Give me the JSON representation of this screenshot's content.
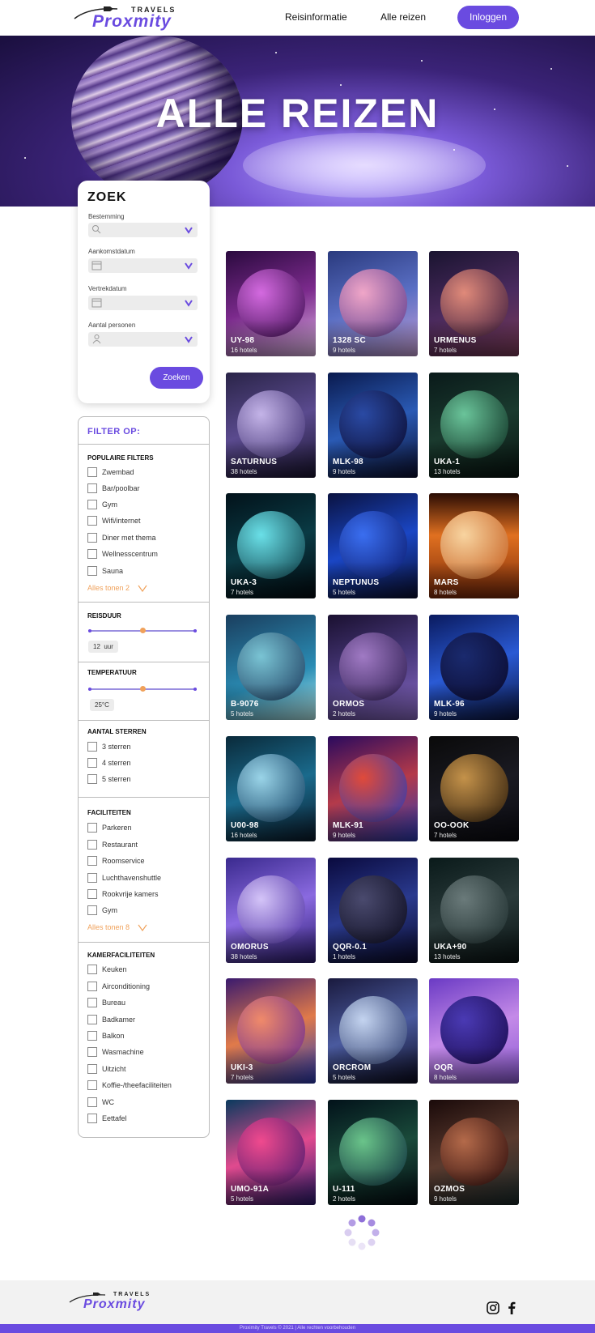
{
  "header": {
    "logo_small": "TRAVELS",
    "logo_main": "Proxmity",
    "nav": [
      "Reisinformatie",
      "Alle reizen"
    ],
    "login_label": "Inloggen"
  },
  "hero": {
    "title": "ALLE REIZEN"
  },
  "search": {
    "title": "ZOEK",
    "fields": [
      {
        "label": "Bestemming",
        "icon": "search-icon"
      },
      {
        "label": "Aankomstdatum",
        "icon": "calendar-icon"
      },
      {
        "label": "Vertrekdatum",
        "icon": "calendar-icon"
      },
      {
        "label": "Aantal personen",
        "icon": "person-icon"
      }
    ],
    "submit_label": "Zoeken"
  },
  "filters": {
    "title": "FILTER OP:",
    "popular": {
      "title": "POPULAIRE FILTERS",
      "items": [
        "Zwembad",
        "Bar/poolbar",
        "Gym",
        "Wifi/internet",
        "Diner met thema",
        "Wellnesscentrum",
        "Sauna"
      ],
      "show_more": "Alles tonen 2"
    },
    "duration": {
      "title": "REISDUUR",
      "value": "12",
      "unit": "uur",
      "level": 0.5
    },
    "temperature": {
      "title": "TEMPERATUUR",
      "value": "25°C",
      "level": 0.5
    },
    "stars": {
      "title": "AANTAL STERREN",
      "items": [
        "3 sterren",
        "4 sterren",
        "5 sterren"
      ]
    },
    "facilities": {
      "title": "FACILITEITEN",
      "items": [
        "Parkeren",
        "Restaurant",
        "Roomservice",
        "Luchthavenshuttle",
        "Rookvrije kamers",
        "Gym"
      ],
      "show_more": "Alles tonen 8"
    },
    "room": {
      "title": "KAMERFACILITEITEN",
      "items": [
        "Keuken",
        "Airconditioning",
        "Bureau",
        "Badkamer",
        "Balkon",
        "Wasmachine",
        "Uitzicht",
        "Koffie-/theefaciliteiten",
        "WC",
        "Eettafel"
      ]
    }
  },
  "destinations": [
    {
      "name": "UY-98",
      "hotels": "16 hotels"
    },
    {
      "name": "1328 SC",
      "hotels": "9 hotels"
    },
    {
      "name": "URMENUS",
      "hotels": "7 hotels"
    },
    {
      "name": "SATURNUS",
      "hotels": "38 hotels"
    },
    {
      "name": "MLK-98",
      "hotels": "9 hotels"
    },
    {
      "name": "UKA-1",
      "hotels": "13 hotels"
    },
    {
      "name": "UKA-3",
      "hotels": "7 hotels"
    },
    {
      "name": "NEPTUNUS",
      "hotels": "5 hotels"
    },
    {
      "name": "MARS",
      "hotels": "8 hotels"
    },
    {
      "name": "B-9076",
      "hotels": "5 hotels"
    },
    {
      "name": "ORMOS",
      "hotels": "2 hotels"
    },
    {
      "name": "MLK-96",
      "hotels": "9 hotels"
    },
    {
      "name": "U00-98",
      "hotels": "16 hotels"
    },
    {
      "name": "MLK-91",
      "hotels": "9 hotels"
    },
    {
      "name": "OO-OOK",
      "hotels": "7 hotels"
    },
    {
      "name": "OMORUS",
      "hotels": "38 hotels"
    },
    {
      "name": "QQR-0.1",
      "hotels": "1 hotels"
    },
    {
      "name": "UKA+90",
      "hotels": "13 hotels"
    },
    {
      "name": "UKI-3",
      "hotels": "7 hotels"
    },
    {
      "name": "ORCROM",
      "hotels": "5 hotels"
    },
    {
      "name": "OQR",
      "hotels": "8 hotels"
    },
    {
      "name": "UMO-91A",
      "hotels": "5 hotels"
    },
    {
      "name": "U-111",
      "hotels": "2 hotels"
    },
    {
      "name": "OZMOS",
      "hotels": "9 hotels"
    }
  ],
  "footer": {
    "logo_small": "TRAVELS",
    "logo_main": "Proxmity",
    "social": [
      "instagram-icon",
      "facebook-icon"
    ],
    "copyright": "Proximity Travels © 2021 | Alle rechten voorbehouden"
  },
  "colors": {
    "accent": "#6a4be0",
    "orange": "#f0a15a"
  }
}
